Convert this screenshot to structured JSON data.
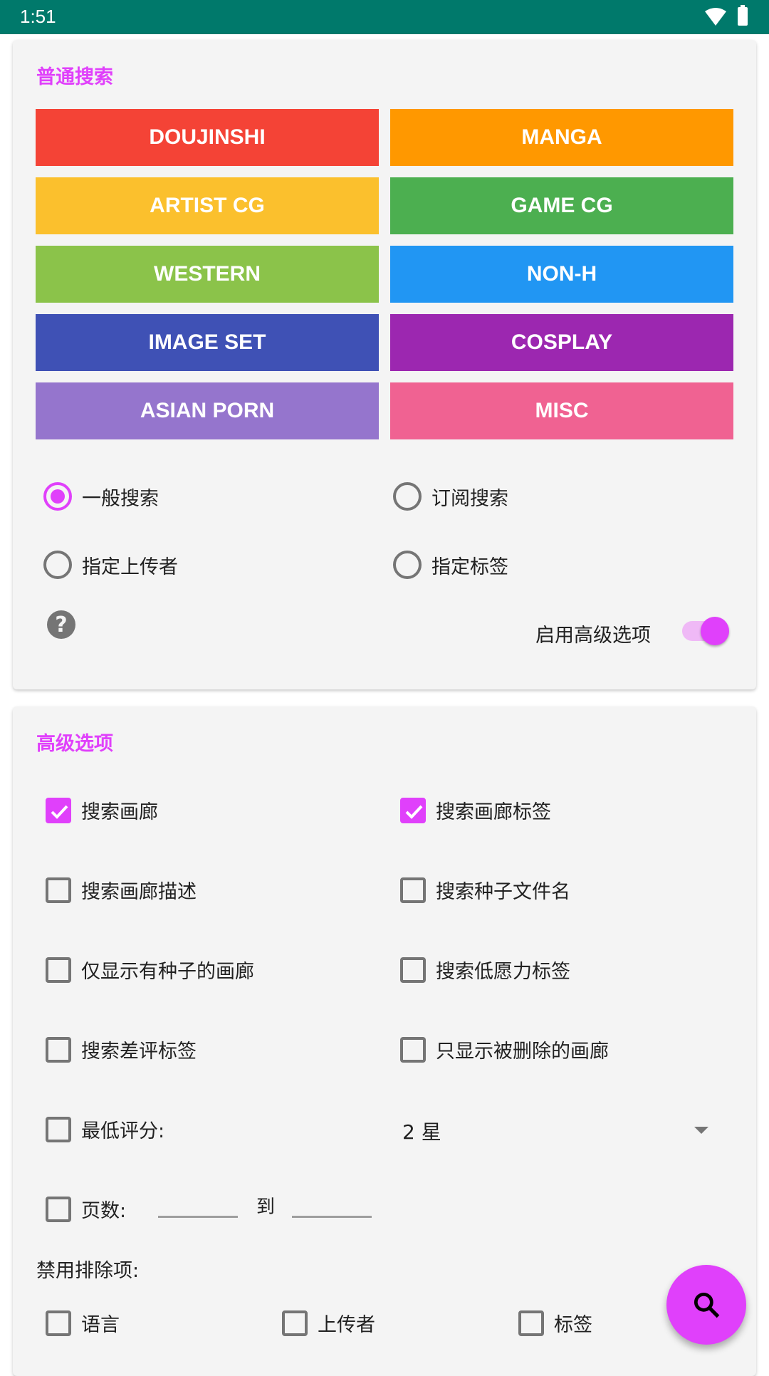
{
  "status_bar": {
    "time": "1:51"
  },
  "normal_search": {
    "title": "普通搜索",
    "categories": [
      {
        "label": "DOUJINSHI",
        "color": "#f44336"
      },
      {
        "label": "MANGA",
        "color": "#ff9800"
      },
      {
        "label": "ARTIST CG",
        "color": "#fbc02d"
      },
      {
        "label": "GAME CG",
        "color": "#4caf50"
      },
      {
        "label": "WESTERN",
        "color": "#8bc34a"
      },
      {
        "label": "NON-H",
        "color": "#2196f3"
      },
      {
        "label": "IMAGE SET",
        "color": "#3f51b5"
      },
      {
        "label": "COSPLAY",
        "color": "#9c27b0"
      },
      {
        "label": "ASIAN PORN",
        "color": "#9575cd"
      },
      {
        "label": "MISC",
        "color": "#f06292"
      }
    ],
    "search_modes": [
      {
        "label": "一般搜索",
        "selected": true
      },
      {
        "label": "订阅搜索",
        "selected": false
      },
      {
        "label": "指定上传者",
        "selected": false
      },
      {
        "label": "指定标签",
        "selected": false
      }
    ],
    "help_icon": "?",
    "advanced_toggle": {
      "label": "启用高级选项",
      "on": true
    }
  },
  "advanced": {
    "title": "高级选项",
    "options": [
      {
        "label": "搜索画廊",
        "checked": true
      },
      {
        "label": "搜索画廊标签",
        "checked": true
      },
      {
        "label": "搜索画廊描述",
        "checked": false
      },
      {
        "label": "搜索种子文件名",
        "checked": false
      },
      {
        "label": "仅显示有种子的画廊",
        "checked": false
      },
      {
        "label": "搜索低愿力标签",
        "checked": false
      },
      {
        "label": "搜索差评标签",
        "checked": false
      },
      {
        "label": "只显示被删除的画廊",
        "checked": false
      }
    ],
    "min_rating": {
      "label": "最低评分:",
      "checked": false,
      "value": "2 星"
    },
    "pages": {
      "label": "页数:",
      "checked": false,
      "from": "",
      "to_label": "到",
      "to": ""
    },
    "disable_exclusions": {
      "label": "禁用排除项:",
      "items": [
        {
          "label": "语言",
          "checked": false
        },
        {
          "label": "上传者",
          "checked": false
        },
        {
          "label": "标签",
          "checked": false
        }
      ]
    }
  },
  "accent_color": "#e040fb",
  "fab": {
    "icon": "search-icon"
  }
}
